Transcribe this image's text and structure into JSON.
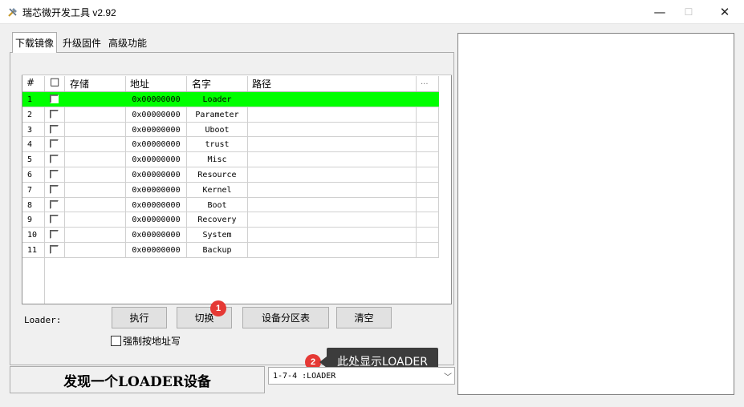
{
  "window": {
    "title": "瑞芯微开发工具 v2.92"
  },
  "tabs": [
    {
      "label": "下载镜像"
    },
    {
      "label": "升级固件"
    },
    {
      "label": "高级功能"
    }
  ],
  "table": {
    "headers": {
      "num": "#",
      "check": "□",
      "storage": "存储",
      "address": "地址",
      "name": "名字",
      "path": "路径",
      "more": "..."
    },
    "rows": [
      {
        "num": "1",
        "address": "0x00000000",
        "name": "Loader",
        "path": ""
      },
      {
        "num": "2",
        "address": "0x00000000",
        "name": "Parameter",
        "path": ""
      },
      {
        "num": "3",
        "address": "0x00000000",
        "name": "Uboot",
        "path": ""
      },
      {
        "num": "4",
        "address": "0x00000000",
        "name": "trust",
        "path": ""
      },
      {
        "num": "5",
        "address": "0x00000000",
        "name": "Misc",
        "path": ""
      },
      {
        "num": "6",
        "address": "0x00000000",
        "name": "Resource",
        "path": ""
      },
      {
        "num": "7",
        "address": "0x00000000",
        "name": "Kernel",
        "path": ""
      },
      {
        "num": "8",
        "address": "0x00000000",
        "name": "Boot",
        "path": ""
      },
      {
        "num": "9",
        "address": "0x00000000",
        "name": "Recovery",
        "path": ""
      },
      {
        "num": "10",
        "address": "0x00000000",
        "name": "System",
        "path": ""
      },
      {
        "num": "11",
        "address": "0x00000000",
        "name": "Backup",
        "path": ""
      }
    ],
    "selected_row_color": "#00ff00"
  },
  "controls": {
    "loader_label": "Loader:",
    "run_button": "执行",
    "switch_button": "切换",
    "partition_button": "设备分区表",
    "clear_button": "清空",
    "force_address_label": "强制按地址写"
  },
  "annotations": {
    "badge1": "1",
    "badge2": "2",
    "tooltip": "此处显示LOADER",
    "badge_color": "#e53935"
  },
  "status": {
    "message": "发现一个LOADER设备",
    "device_combo_value": "1-7-4 :LOADER"
  }
}
